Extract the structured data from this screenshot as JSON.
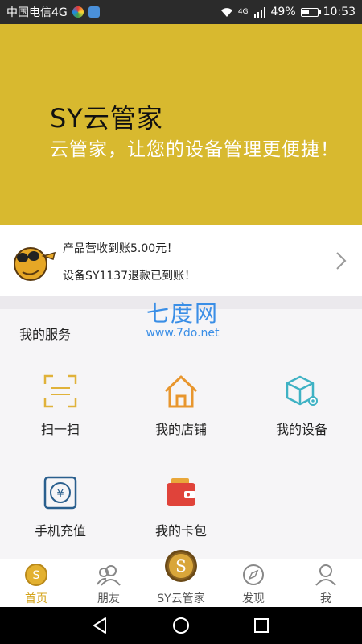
{
  "status_bar": {
    "carrier": "中国电信4G",
    "network_tag": "4G",
    "battery": "49%",
    "time": "10:53"
  },
  "banner": {
    "title": "SY云管家",
    "subtitle": "云管家，让您的设备管理更便捷！",
    "bg_color": "#d8b92f"
  },
  "notice": {
    "line1": "产品营收到账5.00元！",
    "line2": "设备SY1137退款已到账！"
  },
  "watermark": {
    "big": "七度网",
    "small": "www.7do.net"
  },
  "services": {
    "title": "我的服务",
    "items": [
      {
        "label": "扫一扫",
        "icon": "scan-icon"
      },
      {
        "label": "我的店铺",
        "icon": "store-icon"
      },
      {
        "label": "我的设备",
        "icon": "device-icon"
      },
      {
        "label": "手机充值",
        "icon": "recharge-icon"
      },
      {
        "label": "我的卡包",
        "icon": "wallet-icon"
      }
    ]
  },
  "tabs": [
    {
      "label": "首页",
      "icon": "home-coin-icon",
      "active": true
    },
    {
      "label": "朋友",
      "icon": "friends-icon"
    },
    {
      "label": "SY云管家",
      "icon": "sy-coin-icon"
    },
    {
      "label": "发现",
      "icon": "compass-icon"
    },
    {
      "label": "我",
      "icon": "profile-icon"
    }
  ],
  "colors": {
    "accent": "#d4a41c",
    "banner": "#d8b92f",
    "watermark": "#3a8ee6"
  }
}
